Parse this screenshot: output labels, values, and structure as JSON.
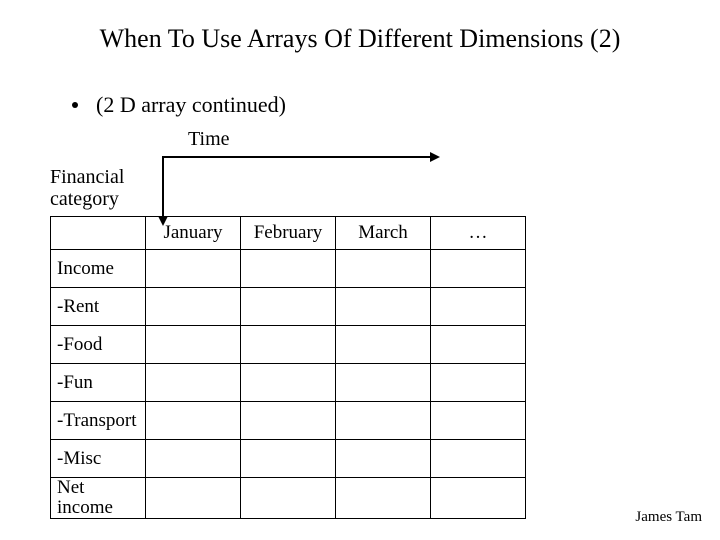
{
  "title": "When To Use Arrays Of Different Dimensions (2)",
  "bullet": "(2 D array continued)",
  "axes": {
    "horizontal": "Time",
    "vertical_line1": "Financial",
    "vertical_line2": "category"
  },
  "table": {
    "columns": [
      "January",
      "February",
      "March",
      "…"
    ],
    "rows": [
      "Income",
      "-Rent",
      "-Food",
      "-Fun",
      "-Transport",
      "-Misc",
      "Net income"
    ]
  },
  "footer": "James Tam",
  "chart_data": {
    "type": "table",
    "title": "Financial category by month (2D array layout)",
    "xlabel": "Time (months)",
    "ylabel": "Financial category",
    "columns": [
      "January",
      "February",
      "March",
      "…"
    ],
    "rows": [
      "Income",
      "-Rent",
      "-Food",
      "-Fun",
      "-Transport",
      "-Misc",
      "Net income"
    ],
    "values": [
      [
        null,
        null,
        null,
        null
      ],
      [
        null,
        null,
        null,
        null
      ],
      [
        null,
        null,
        null,
        null
      ],
      [
        null,
        null,
        null,
        null
      ],
      [
        null,
        null,
        null,
        null
      ],
      [
        null,
        null,
        null,
        null
      ],
      [
        null,
        null,
        null,
        null
      ]
    ]
  }
}
